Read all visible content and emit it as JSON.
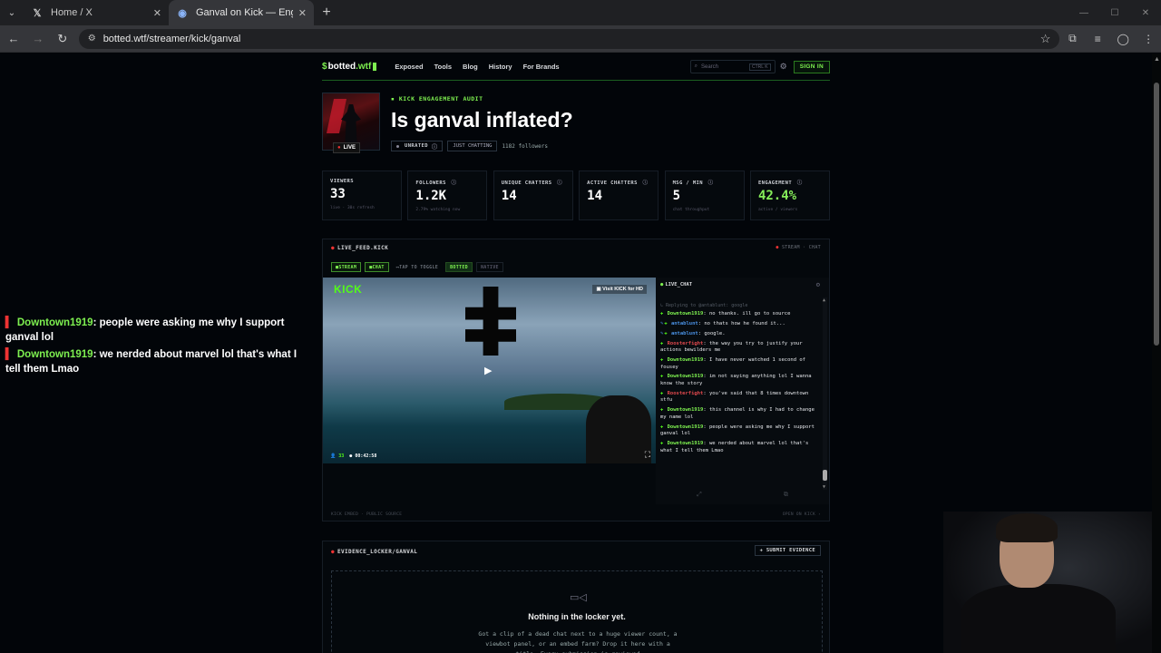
{
  "browser": {
    "tabs": [
      {
        "title": "Home / X",
        "icon": "x-logo-icon"
      },
      {
        "title": "Ganval on Kick — Engagement",
        "icon": "botted-favicon-icon"
      }
    ],
    "url": "botted.wtf/streamer/kick/ganval"
  },
  "site": {
    "logo": {
      "prefix": "$",
      "name": "botted",
      "tld": ".wtf"
    },
    "nav": [
      "Exposed",
      "Tools",
      "Blog",
      "History",
      "For Brands"
    ],
    "search": {
      "placeholder": "Search",
      "shortcut": "CTRL K"
    },
    "signin": "SIGN IN"
  },
  "hero": {
    "eyebrow": "KICK ENGAGEMENT AUDIT",
    "title": "Is ganval inflated?",
    "live": "LIVE",
    "rating": "UNRATED",
    "category": "JUST CHATTING",
    "followers": "1182 followers"
  },
  "stats": [
    {
      "label": "VIEWERS",
      "value": "33",
      "sub": "live · 30s refresh",
      "green": false
    },
    {
      "label": "FOLLOWERS",
      "value": "1.2K",
      "sub": "2.79% watching now",
      "green": false
    },
    {
      "label": "UNIQUE CHATTERS",
      "value": "14",
      "sub": "",
      "green": false
    },
    {
      "label": "ACTIVE CHATTERS",
      "value": "14",
      "sub": "",
      "green": false
    },
    {
      "label": "MSG / MIN",
      "value": "5",
      "sub": "chat throughput",
      "green": false
    },
    {
      "label": "ENGAGEMENT",
      "value": "42.4%",
      "sub": "active / viewers",
      "green": true
    }
  ],
  "feed": {
    "title": "LIVE_FEED.KICK",
    "right": "STREAM · CHAT",
    "toggles": {
      "stream": "STREAM",
      "chat": "CHAT",
      "hint": "TAP TO TOGGLE",
      "botted": "BOTTED",
      "native": "NATIVE"
    },
    "video": {
      "brand": "KICK",
      "visit": "Visit KICK for HD",
      "viewers": "33",
      "time": "00:42:58"
    },
    "footer_left": "KICK EMBED · PUBLIC SOURCE",
    "footer_right": "OPEN ON KICK ›"
  },
  "chat": {
    "title": "LIVE_CHAT",
    "reply": "Replying to @antablunt: google",
    "messages": [
      {
        "user": "Downtown1919",
        "color": "#7ef050",
        "badge": "green",
        "text": "no thanks. ill go to source"
      },
      {
        "user": "antablunt",
        "color": "#4a90e2",
        "badge": "blue",
        "text": "no thats how he found it..."
      },
      {
        "user": "antablunt",
        "color": "#4a90e2",
        "badge": "blue",
        "text": "google."
      },
      {
        "user": "Roosterfight",
        "color": "#e0484d",
        "badge": "green",
        "text": "the way you try to justify your actions bewilders me"
      },
      {
        "user": "Downtown1919",
        "color": "#7ef050",
        "badge": "green",
        "text": "I have never watched 1 second of fousey"
      },
      {
        "user": "Downtown1919",
        "color": "#7ef050",
        "badge": "green",
        "text": "im not saying anything lol I wanna know the story"
      },
      {
        "user": "Roosterfight",
        "color": "#e0484d",
        "badge": "green",
        "text": "you've said that 8 times downtown stfu"
      },
      {
        "user": "Downtown1919",
        "color": "#7ef050",
        "badge": "green",
        "text": "this channel is why I had to change my name lol"
      },
      {
        "user": "Downtown1919",
        "color": "#7ef050",
        "badge": "green",
        "text": "people were asking me why I support ganval lol"
      },
      {
        "user": "Downtown1919",
        "color": "#7ef050",
        "badge": "green",
        "text": "we nerded about marvel lol that's what I tell them Lmao"
      }
    ]
  },
  "evidence": {
    "title": "EVIDENCE_LOCKER/GANVAL",
    "button": "+ SUBMIT EVIDENCE",
    "empty_title": "Nothing in the locker yet.",
    "empty_desc": "Got a clip of a dead chat next to a huge viewer count, a viewbot panel, or an embed farm? Drop it here with a title. Every submission is reviewed"
  },
  "overlay": [
    {
      "user": "Downtown1919",
      "text": ": people were asking me why I support ganval lol"
    },
    {
      "user": "Downtown1919",
      "text": ": we nerded about marvel lol that's what I tell them Lmao"
    }
  ]
}
